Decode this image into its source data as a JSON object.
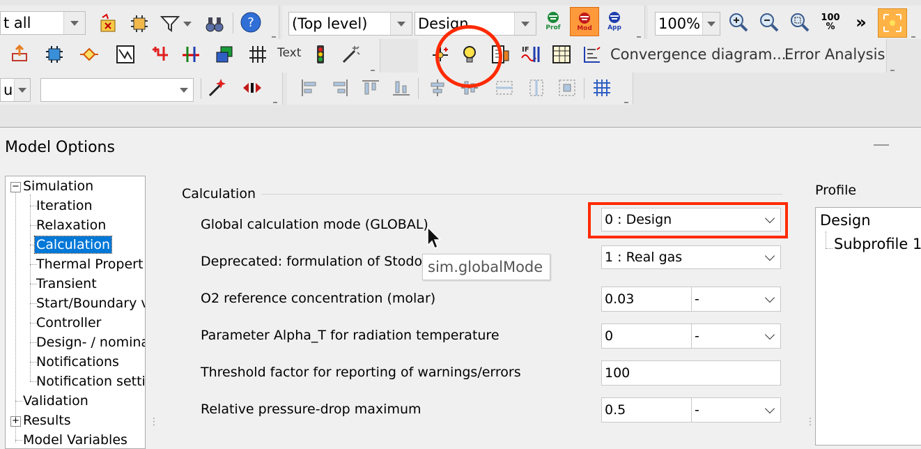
{
  "toolbar": {
    "select_combo_value": "t all",
    "level_combo_value": "(Top level)",
    "profile_combo_value": "Design",
    "zoom_combo_value": "100%",
    "mode_prof_label": "Prof",
    "mode_mod_label": "Mod",
    "mode_app_label": "App",
    "zoom100_label": "100\n%",
    "text_tool_label": "Text",
    "convergence_label": "Convergence diagram...",
    "error_analysis_label": "Error Analysis",
    "row3_combo_a_value": "u",
    "row3_combo_b_value": ""
  },
  "dialog": {
    "title": "Model Options"
  },
  "tree": {
    "items": [
      {
        "label": "Simulation"
      },
      {
        "label": "Iteration"
      },
      {
        "label": "Relaxation"
      },
      {
        "label": "Calculation"
      },
      {
        "label": "Thermal Propert"
      },
      {
        "label": "Transient"
      },
      {
        "label": "Start/Boundary v"
      },
      {
        "label": "Controller"
      },
      {
        "label": "Design- / nomina"
      },
      {
        "label": "Notifications"
      },
      {
        "label": "Notification setti"
      },
      {
        "label": "Validation"
      },
      {
        "label": "Results"
      },
      {
        "label": "Model Variables"
      }
    ]
  },
  "calculation": {
    "section_title": "Calculation",
    "rows": [
      {
        "label": "Global calculation mode (GLOBAL)",
        "value": "0 : Design"
      },
      {
        "label": "Deprecated: formulation of Stodol",
        "value": "1 : Real gas"
      },
      {
        "label": "O2 reference concentration (molar)",
        "value": "0.03",
        "unit": "-"
      },
      {
        "label": "Parameter Alpha_T for radiation temperature",
        "value": "0",
        "unit": "-"
      },
      {
        "label": "Threshold factor for reporting of warnings/errors",
        "value": "100"
      },
      {
        "label": "Relative pressure-drop maximum",
        "value": "0.5",
        "unit": "-"
      }
    ]
  },
  "tooltip": {
    "text": "sim.globalMode"
  },
  "profile": {
    "label": "Profile",
    "items": [
      {
        "label": "Design"
      },
      {
        "label": "Subprofile 1"
      }
    ]
  },
  "colors": {
    "highlight": "#ff2a00",
    "selection": "#0078d7"
  }
}
